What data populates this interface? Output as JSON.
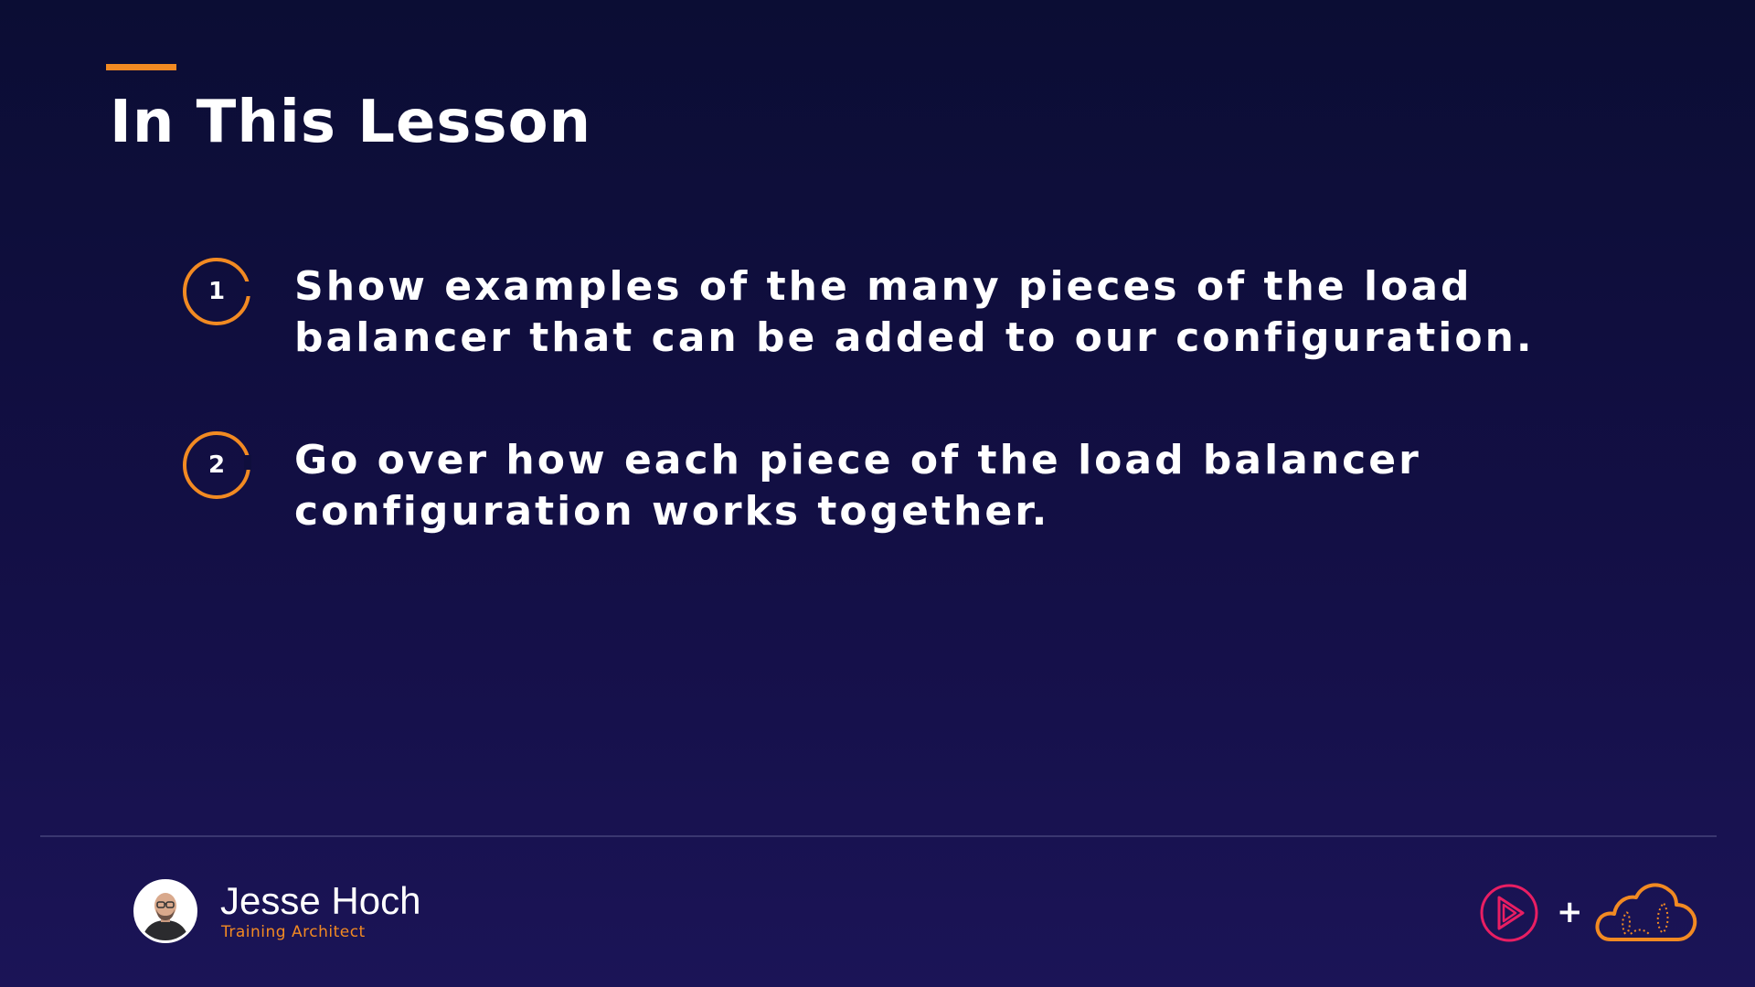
{
  "slide": {
    "title": "In This Lesson",
    "accent_color": "#f28a22",
    "objectives": [
      {
        "number": "1",
        "text": "Show examples of the many pieces of the load balancer that can be added to our configuration."
      },
      {
        "number": "2",
        "text": "Go over how each piece of the load balancer configuration works together."
      }
    ]
  },
  "footer": {
    "presenter_name": "Jesse Hoch",
    "presenter_role": "Training Architect",
    "plus_symbol": "+",
    "icons": [
      "avatar",
      "pluralsight-play-logo-icon",
      "acloudguru-cloud-logo-icon"
    ]
  }
}
